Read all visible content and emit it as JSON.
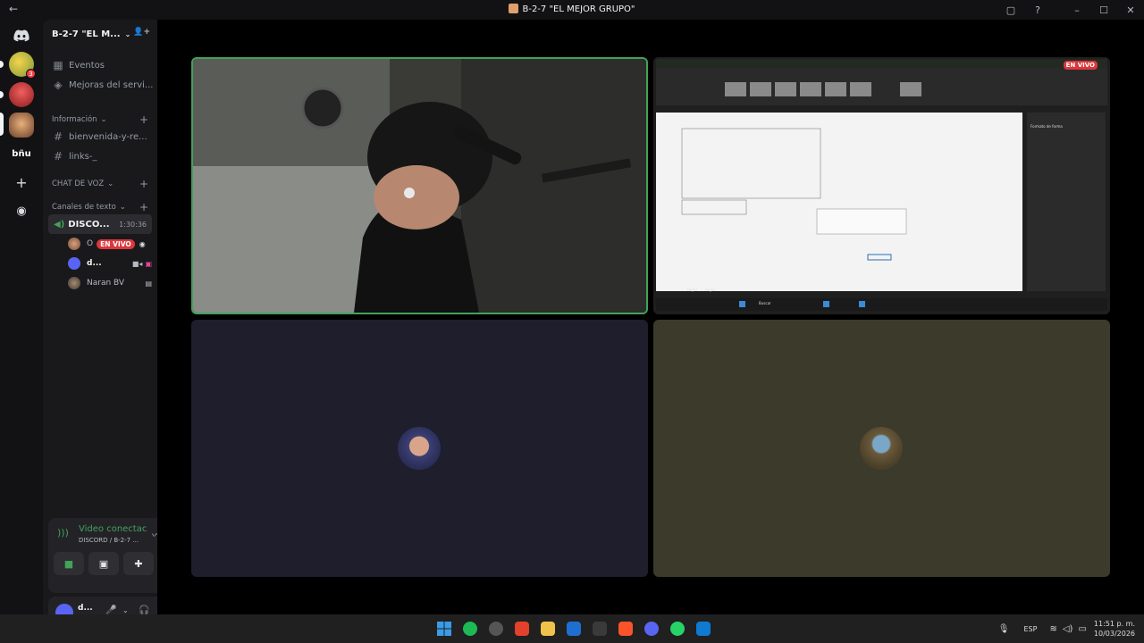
{
  "window": {
    "title": "B-2-7 \"EL MEJOR GRUPO\"",
    "back_icon": "←",
    "inbox_icon": "▢",
    "help_icon": "?",
    "minimize_icon": "–",
    "maximize_icon": "☐",
    "close_icon": "✕"
  },
  "servers": {
    "badge_count": "3",
    "bfu_label": "bñu",
    "add_icon": "+",
    "discover_icon": "◉"
  },
  "guild": {
    "name": "B-2-7 \"EL M...",
    "chevron": "⌄",
    "invite_icon": "👤+"
  },
  "nav": {
    "events": "Eventos",
    "improvements": "Mejoras del servi..."
  },
  "categories": {
    "info": "Información",
    "voice": "CHAT DE VOZ",
    "text": "Canales de texto",
    "chevron": "⌄",
    "plus": "+"
  },
  "channels": {
    "welcome": "bienvenida-y-re...",
    "links": "links-_",
    "hash": "#"
  },
  "voice_channel": {
    "name": "DISCO...",
    "timer": "1:30:36"
  },
  "voice_users": [
    {
      "name": "O",
      "live_label": "EN VIVO"
    },
    {
      "name": "d..."
    },
    {
      "name": "Naran BV"
    }
  ],
  "rtc": {
    "status": "Video conectac",
    "sub": "DISCORD / B-2-7 ...",
    "signal_icon": "📶",
    "noise_icon": "〰",
    "disconnect_icon": "☎",
    "camera_icon": "■",
    "screen_icon": "▣",
    "activity_icon": "✚",
    "soundboard_icon": "✺"
  },
  "user_panel": {
    "name": "d...",
    "mic_icon": "🎤",
    "headset_icon": "🎧",
    "settings_icon": "⚙",
    "caret": "⌄"
  },
  "stream": {
    "live_label": "EN VIVO",
    "sheet_tabs": [
      "Hoja1",
      "Hoja2"
    ],
    "sheet_search": "Buscar",
    "sidepanel_title": "Formato de forma"
  },
  "taskbar": {
    "lang": "ESP",
    "time": "11:51 p. m.",
    "date": "10/03/2026",
    "app_colors": [
      "#2f7fd8",
      "#1db954",
      "#555555",
      "#e3412b",
      "#f1c24b",
      "#1f6fd1",
      "#3a3a3a",
      "#fb542b",
      "#5865f2",
      "#25d366",
      "#0e7ad2"
    ]
  }
}
